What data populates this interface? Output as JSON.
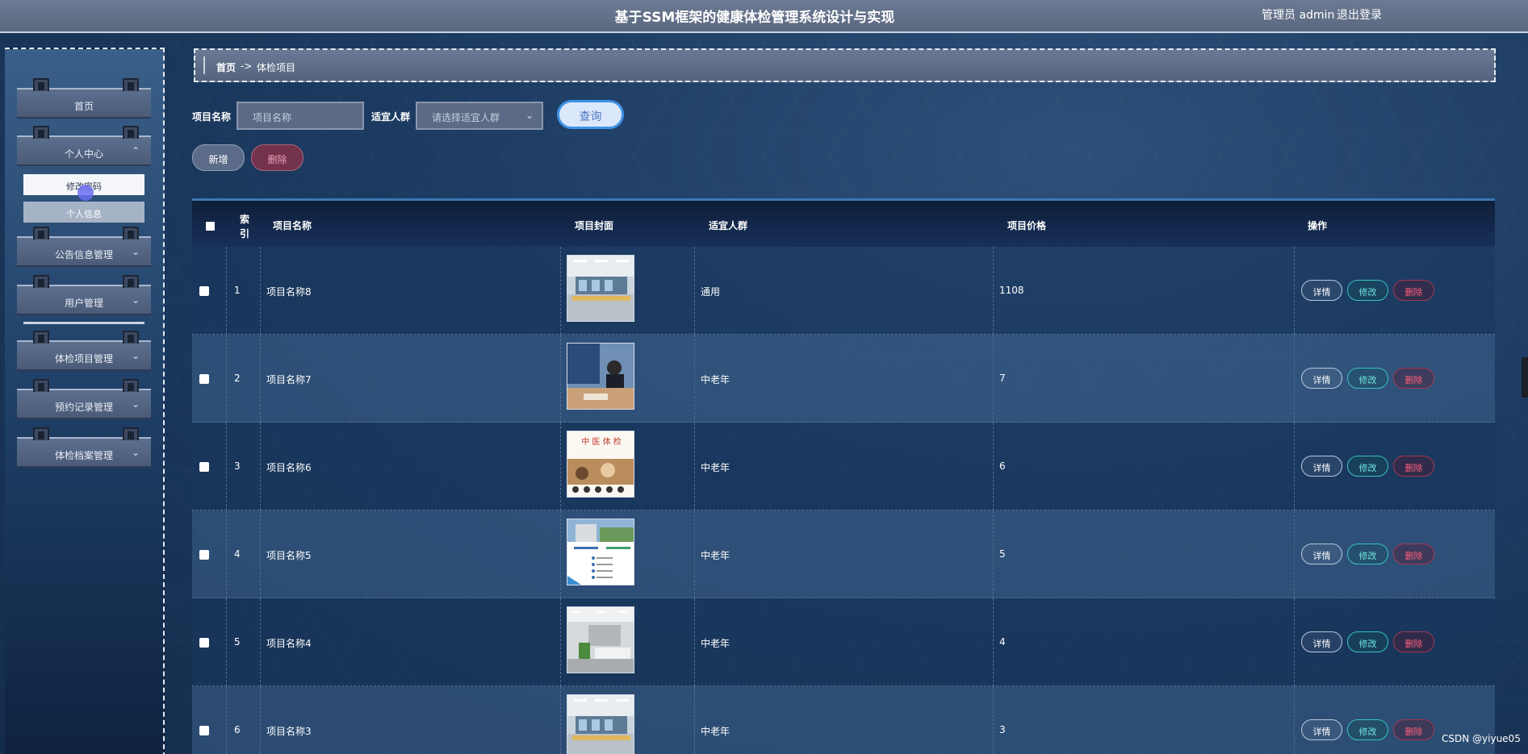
{
  "header": {
    "title": "基于SSM框架的健康体检管理系统设计与实现",
    "user": "管理员 admin",
    "logout": "退出登录"
  },
  "sidebar": {
    "items": [
      {
        "label": "首页",
        "chevron": ""
      },
      {
        "label": "个人中心",
        "chevron": "^"
      },
      {
        "label": "公告信息管理",
        "chevron": "v"
      },
      {
        "label": "用户管理",
        "chevron": "v"
      },
      {
        "label": "体检项目管理",
        "chevron": "v"
      },
      {
        "label": "预约记录管理",
        "chevron": "v"
      },
      {
        "label": "体检档案管理",
        "chevron": "v"
      }
    ],
    "subitems": [
      {
        "label": "修改密码"
      },
      {
        "label": "个人信息"
      }
    ]
  },
  "breadcrumb": {
    "home": "首页",
    "separator": "->",
    "current": "体检项目"
  },
  "search": {
    "name_label": "项目名称",
    "name_placeholder": "项目名称",
    "crowd_label": "适宜人群",
    "crowd_placeholder": "请选择适宜人群",
    "query_button": "查询"
  },
  "actions": {
    "add": "新增",
    "delete": "删除"
  },
  "table": {
    "columns": {
      "index": "索引",
      "name": "项目名称",
      "cover": "项目封面",
      "crowd": "适宜人群",
      "price": "项目价格",
      "ops": "操作"
    },
    "row_buttons": {
      "detail": "详情",
      "edit": "修改",
      "delete": "删除"
    },
    "rows": [
      {
        "index": "1",
        "name": "项目名称8",
        "crowd": "通用",
        "price": "1108"
      },
      {
        "index": "2",
        "name": "项目名称7",
        "crowd": "中老年",
        "price": "7"
      },
      {
        "index": "3",
        "name": "项目名称6",
        "crowd": "中老年",
        "price": "6"
      },
      {
        "index": "4",
        "name": "项目名称5",
        "crowd": "中老年",
        "price": "5"
      },
      {
        "index": "5",
        "name": "项目名称4",
        "crowd": "中老年",
        "price": "4"
      },
      {
        "index": "6",
        "name": "项目名称3",
        "crowd": "中老年",
        "price": "3"
      }
    ]
  },
  "thumb_texts": {
    "t3": "中 医 体 检"
  },
  "watermark": "CSDN @yiyue05",
  "colors": {
    "accent_blue": "#3f93e8",
    "edit_teal": "#35c3c3",
    "delete_red": "#ff5f7a"
  }
}
